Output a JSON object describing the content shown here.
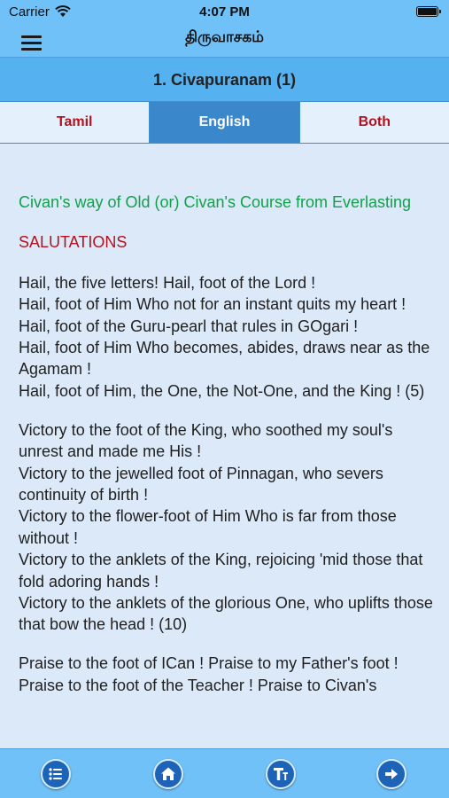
{
  "status_bar": {
    "carrier": "Carrier",
    "time": "4:07 PM"
  },
  "header": {
    "title": "திருவாசகம்",
    "menu_icon": "hamburger-menu-icon"
  },
  "chapter": {
    "title": "1. Civapuranam (1)"
  },
  "tabs": [
    {
      "label": "Tamil",
      "active": false
    },
    {
      "label": "English",
      "active": true
    },
    {
      "label": "Both",
      "active": false
    }
  ],
  "content": {
    "heading": "Civan's way of Old (or) Civan's Course from Everlasting",
    "subheading": "SALUTATIONS",
    "stanzas": [
      {
        "lines": [
          "Hail, the five letters! Hail, foot of the Lord !",
          "Hail, foot of Him Who not for an instant quits my heart !",
          "Hail, foot of the Guru-pearl that rules in GOgari !",
          "Hail, foot of Him Who becomes, abides, draws near as the Agamam !",
          "Hail, foot of Him, the One, the Not-One, and the King ! (5)"
        ]
      },
      {
        "lines": [
          "Victory to the foot of the King, who soothed my soul's unrest and made me His !",
          "Victory to the jewelled foot of Pinnagan, who severs continuity of birth !",
          "Victory to the flower-foot of Him Who is far from those without !",
          "Victory to the anklets of the King, rejoicing 'mid those that fold adoring hands !",
          "Victory to the anklets of the glorious One, who uplifts those that bow the head ! (10)"
        ]
      },
      {
        "lines": [
          "Praise to the foot of ICan ! Praise to my Father's foot !",
          "Praise to the foot of the Teacher ! Praise to Civan's"
        ]
      }
    ]
  },
  "bottom_nav": {
    "buttons": [
      {
        "name": "list-icon"
      },
      {
        "name": "home-icon"
      },
      {
        "name": "text-size-icon"
      },
      {
        "name": "arrow-right-icon"
      }
    ]
  },
  "colors": {
    "bar": "#6fc1f7",
    "chapter_bar": "#56b1f0",
    "active_tab": "#3b87cc",
    "tab_text": "#b3121e",
    "heading": "#10a14a",
    "background": "#dbe9f8",
    "nav_button": "#1d64b8"
  }
}
